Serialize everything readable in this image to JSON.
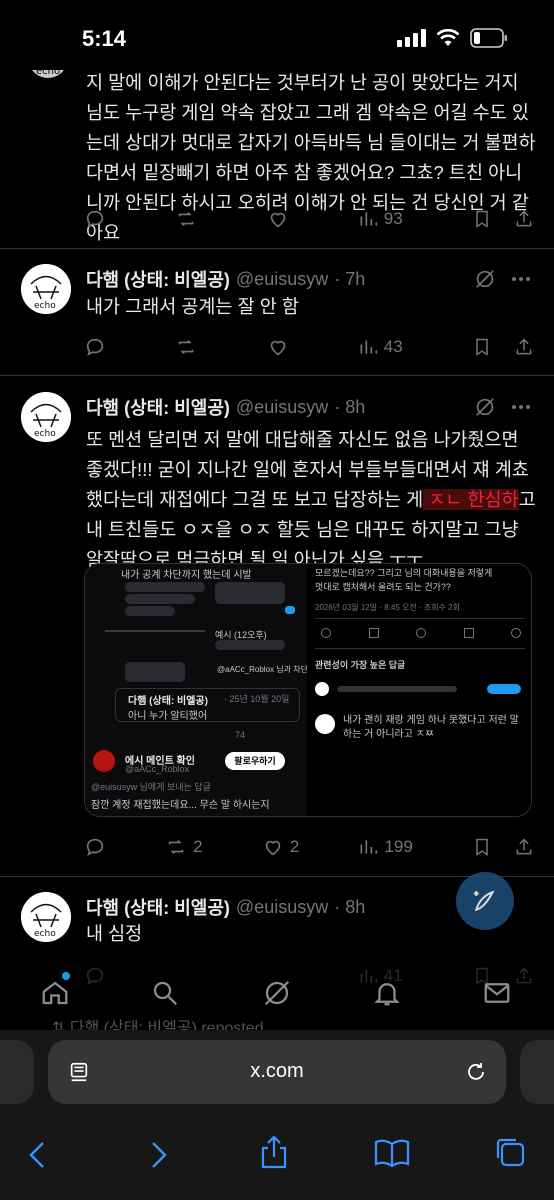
{
  "status": {
    "time": "5:14"
  },
  "post1": {
    "text": "지 말에 이해가 안된다는 것부터가 난 공이 맞았다는 거지 님도 누구랑 게임 약속 잡았고 그래 겜 약속은 어길 수도 있는데 상대가 멋대로 갑자기 아득바득 님 들이대는 거 불편하다면서 밑장빼기 하면 아주 참 좋겠어요? 그쵸? 트친 아니니까 안된다 하시고 오히려 이해가 안 되는 건 당신인 거 같아요",
    "views": "93"
  },
  "post2": {
    "name": "다햄 (상태: 비엘공)",
    "handle": "@euisusyw",
    "time": "· 7h",
    "text": "내가 그래서 공계는 잘 안 함",
    "views": "43"
  },
  "post3": {
    "name": "다햄 (상태: 비엘공)",
    "handle": "@euisusyw",
    "time": "· 8h",
    "text_before": "또 멘션 달리면 저 말에 대답해줄 자신도 없음 나가줬으면 좋겠다!!! 굳이 지나간 일에 혼자서 부들부들대면서 쟤 계쵸했다는데 재접에다 그걸 또 보고 답장하는 게",
    "text_highlight": " ㅈㄴ 한심하",
    "text_after": "고 내 트친들도 ㅇㅈ을 ㅇㅈ 할듯 님은 대꾸도 하지말고 그냥 알잘딱으로 먹금하면 될 일 아닌가 싶음 ㅜㅜ...",
    "replies": "2",
    "retweets": "2",
    "likes": "2",
    "views": "199",
    "embed": {
      "top_left": "내가 공계 차단까지 했는데 시발",
      "top_right_1": "모르겠는데요?? 그리고 님의 대화내용을 저렇게",
      "top_right_2": "멋대로 캡처해서 올려도 되는 건가??",
      "date_line": "2026년 03월 12일 · 8:45 오전 · 조회수 2회",
      "relevance": "관련성이 가장 높은 답글",
      "quote_name": "다햄 (상태: 비엘공)",
      "quote_time": "· 25년 10월 20일",
      "quote_text": "아니 누가 알티했어",
      "account_name": "에시 메인트 확인",
      "account_handle": "@aACc_Roblox",
      "follow": "팔로우하기",
      "reply_to": "@euisusyw 님에게 보내는 답글",
      "reply_text": "잠깐 계정 재접했는데요... 무슨 말 하시는지",
      "right_reply": "내가 괜히 재랑 게임 하나 못했다고 저런 말하는 거 아니라고 ㅈㅉ",
      "quote_views": "74",
      "chat_date": "예시 (12오후)",
      "chat_item": "@aACc_Roblox 님과 차단되어"
    }
  },
  "post4": {
    "name": "다햄 (상태: 비엘공)",
    "handle": "@euisusyw",
    "time": "· 8h",
    "text": "내 심정",
    "views": "41"
  },
  "repost_peek": "다햄 (상태: 비엘공) reposted",
  "safari": {
    "url": "x.com"
  }
}
